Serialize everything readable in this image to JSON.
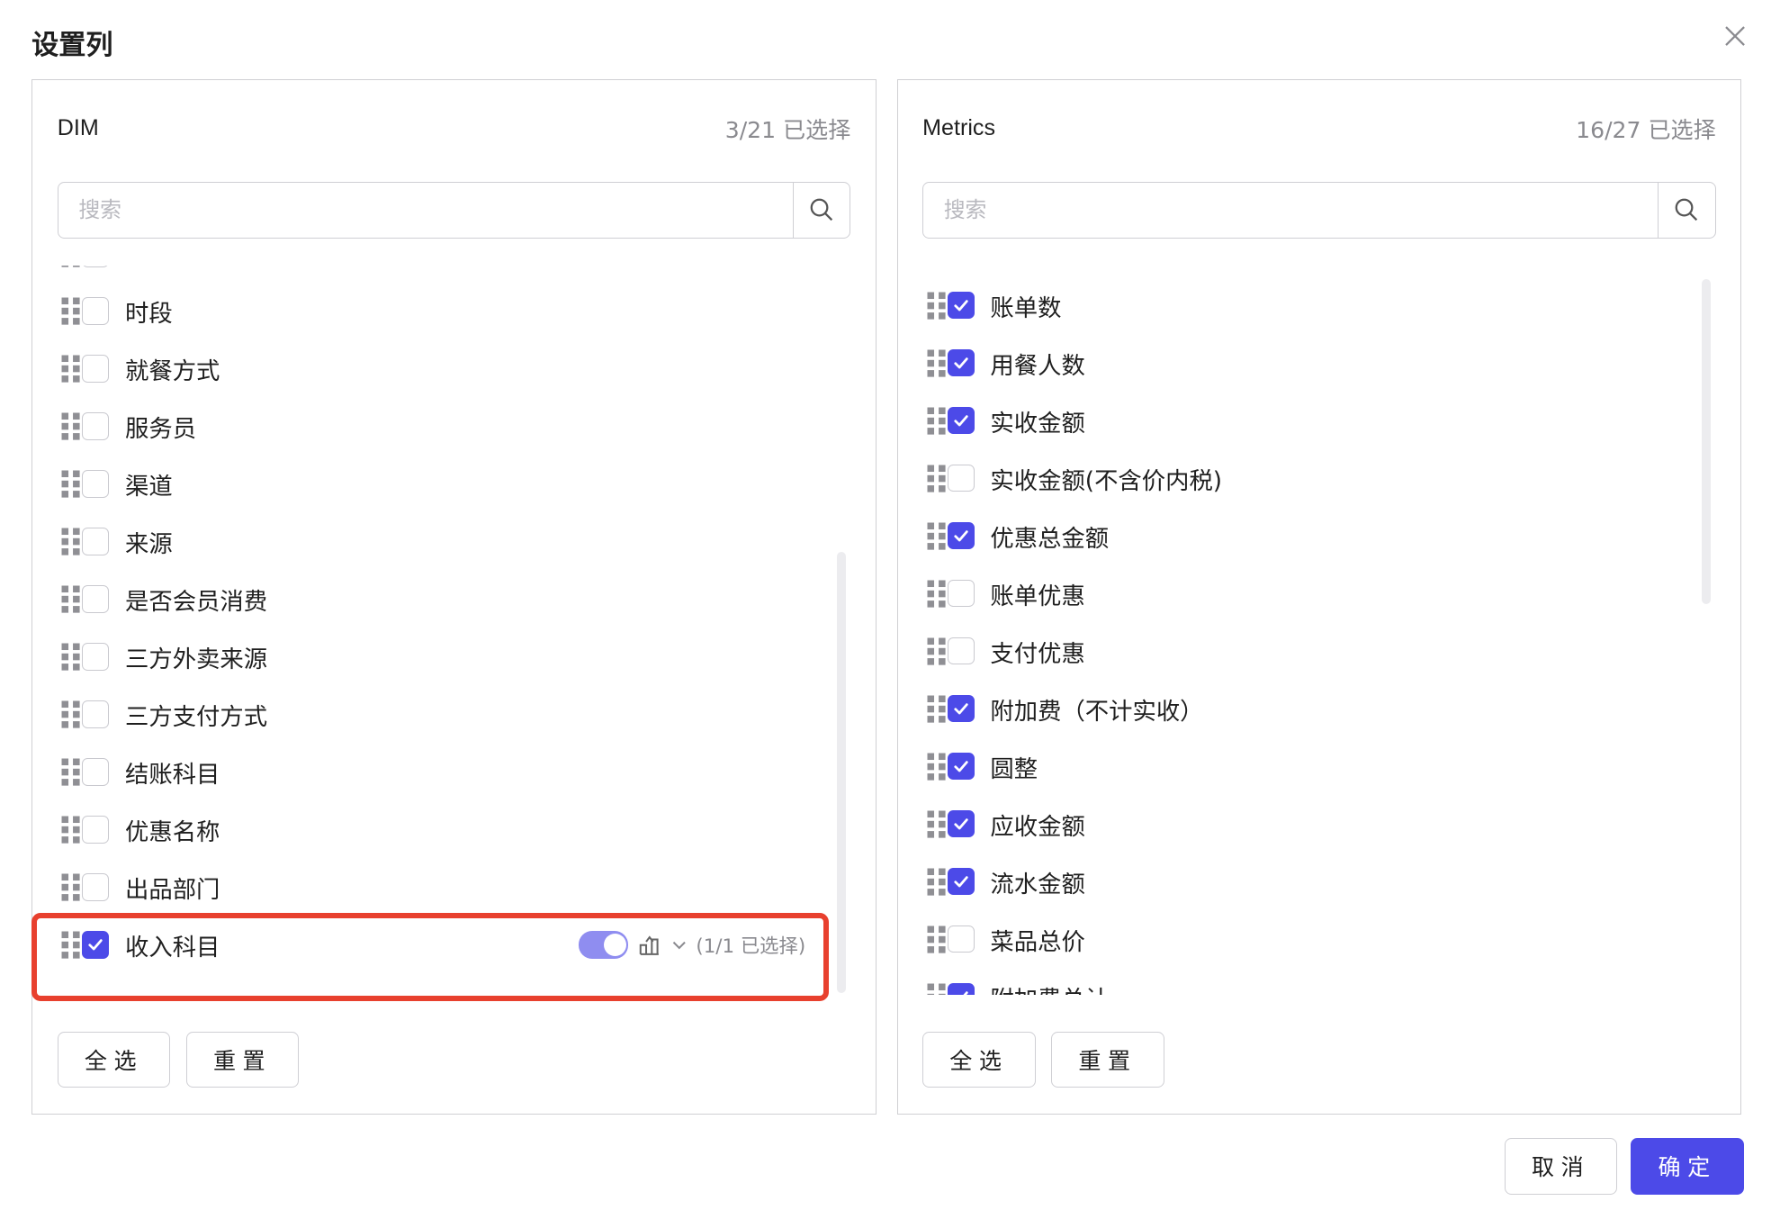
{
  "dialog": {
    "title": "设置列",
    "close_icon": "close-icon"
  },
  "colors": {
    "accent": "#4c4ae8",
    "highlight": "#e8402e",
    "toggle_on": "#8f8df0"
  },
  "left_panel": {
    "title": "DIM",
    "count": "3/21  已选择",
    "search_placeholder": "搜索",
    "items": [
      {
        "label": "",
        "checked": false
      },
      {
        "label": "时段",
        "checked": false
      },
      {
        "label": "就餐方式",
        "checked": false
      },
      {
        "label": "服务员",
        "checked": false
      },
      {
        "label": "渠道",
        "checked": false
      },
      {
        "label": "来源",
        "checked": false
      },
      {
        "label": "是否会员消费",
        "checked": false
      },
      {
        "label": "三方外卖来源",
        "checked": false
      },
      {
        "label": "三方支付方式",
        "checked": false
      },
      {
        "label": "结账科目",
        "checked": false
      },
      {
        "label": "优惠名称",
        "checked": false
      },
      {
        "label": "出品部门",
        "checked": false
      },
      {
        "label": "收入科目",
        "checked": true,
        "toggle_on": true,
        "sub_selection": "(1/1 已选择)"
      }
    ],
    "select_all": "全选",
    "reset": "重置"
  },
  "right_panel": {
    "title": "Metrics",
    "count": "16/27  已选择",
    "search_placeholder": "搜索",
    "items": [
      {
        "label": "账单数",
        "checked": true
      },
      {
        "label": "用餐人数",
        "checked": true
      },
      {
        "label": "实收金额",
        "checked": true
      },
      {
        "label": "实收金额(不含价内税)",
        "checked": false
      },
      {
        "label": "优惠总金额",
        "checked": true
      },
      {
        "label": "账单优惠",
        "checked": false
      },
      {
        "label": "支付优惠",
        "checked": false
      },
      {
        "label": "附加费（不计实收）",
        "checked": true
      },
      {
        "label": "圆整",
        "checked": true
      },
      {
        "label": "应收金额",
        "checked": true
      },
      {
        "label": "流水金额",
        "checked": true
      },
      {
        "label": "菜品总价",
        "checked": false
      },
      {
        "label": "附加费总计",
        "checked": true
      }
    ],
    "select_all": "全选",
    "reset": "重置"
  },
  "footer": {
    "cancel": "取消",
    "confirm": "确定"
  }
}
